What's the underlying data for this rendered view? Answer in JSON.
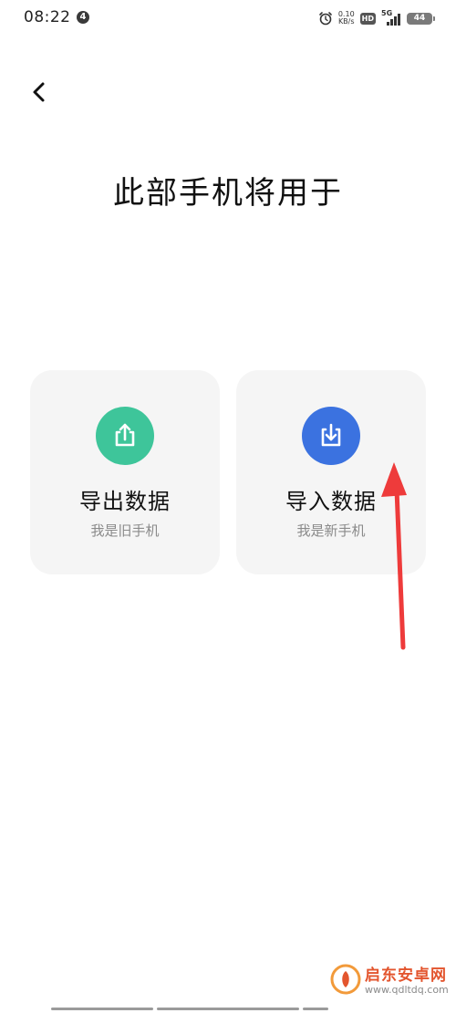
{
  "status_bar": {
    "time": "08:22",
    "notification_count": "4",
    "net_speed_value": "0.10",
    "net_speed_unit": "KB/s",
    "hd_label": "HD",
    "network_label": "5G",
    "battery_level": "44"
  },
  "header": {
    "back_icon": "chevron-left-icon",
    "title": "此部手机将用于"
  },
  "options": [
    {
      "title": "导出数据",
      "subtitle": "我是旧手机",
      "icon": "share-out-icon",
      "color": "#3ec59a"
    },
    {
      "title": "导入数据",
      "subtitle": "我是新手机",
      "icon": "download-into-tray-icon",
      "color": "#3b72e0"
    }
  ],
  "annotation": {
    "color": "#ee3b3b"
  },
  "watermark": {
    "line1": "启东安卓网",
    "line2": "www.qdltdq.com"
  }
}
